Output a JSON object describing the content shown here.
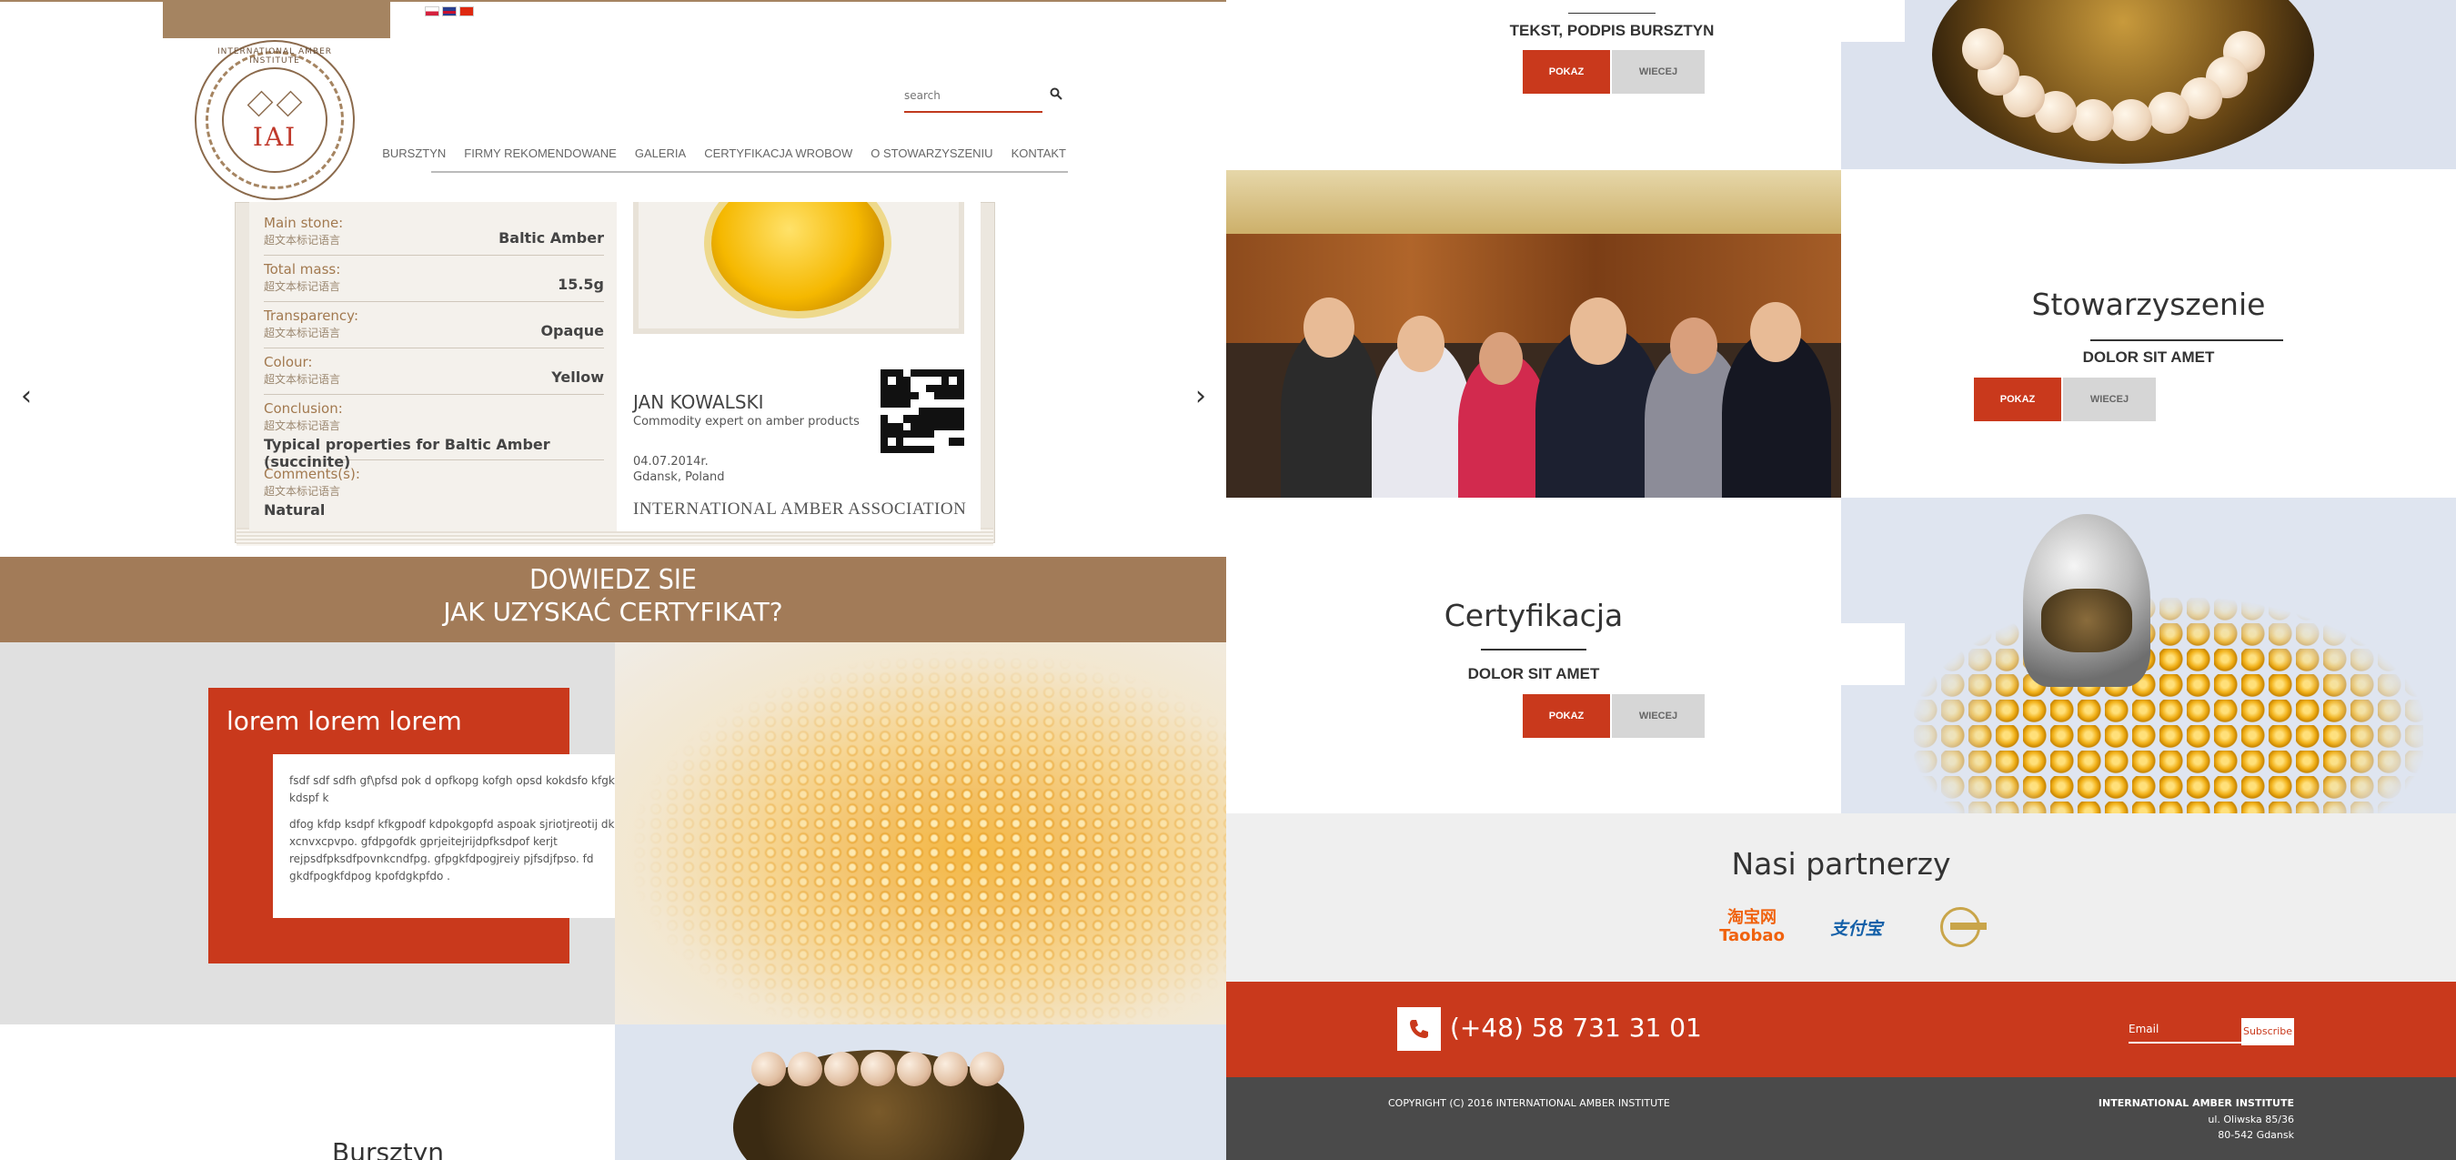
{
  "header": {
    "flags": [
      "pl-flag-icon",
      "en-flag-icon",
      "cn-flag-icon"
    ],
    "logo": {
      "arc_text": "INTERNATIONAL AMBER INSTITUTE",
      "monogram": "IAI"
    },
    "search": {
      "placeholder": "search",
      "icon": "search-icon"
    },
    "nav": [
      "BURSZTYN",
      "FIRMY REKOMENDOWANE",
      "GALERIA",
      "CERTYFIKACJA WROBOW",
      "O STOWARZYSZENIU",
      "KONTAKT"
    ]
  },
  "certificate": {
    "rows": [
      {
        "label": "Main stone:",
        "sub": "超文本标记语言",
        "value": "Baltic Amber"
      },
      {
        "label": "Total mass:",
        "sub": "超文本标记语言",
        "value": "15.5g"
      },
      {
        "label": "Transparency:",
        "sub": "超文本标记语言",
        "value": "Opaque"
      },
      {
        "label": "Colour:",
        "sub": "超文本标记语言",
        "value": "Yellow"
      },
      {
        "label": "Conclusion:",
        "sub": "超文本标记语言",
        "value": "Typical properties for Baltic Amber (succinite)"
      },
      {
        "label": "Comments(s):",
        "sub": "超文本标记语言",
        "value": "Natural"
      }
    ],
    "expert_name": "JAN KOWALSKI",
    "expert_title": "Commodity expert on amber products",
    "date": "04.07.2014r.",
    "place": "Gdansk, Poland",
    "organization": "INTERNATIONAL AMBER ASSOCIATION"
  },
  "slider": {
    "prev": "‹",
    "next": "›"
  },
  "banner": {
    "line1": "DOWIEDZ SIE",
    "line2": "JAK UZYSKAĆ CERTYFIKAT?"
  },
  "info_card": {
    "title": "lorem lorem lorem",
    "paragraph1": "fsdf sdf sdfh gf\\pfsd pok d opfkopg kofgh opsd kokdsfo kfgk dofpg kdspf k",
    "paragraph2": "dfog kfdp ksdpf kfkgpodf kdpokgopfd aspoak sjriotjreotij dk spkfspo xcnvxcpvpo. gfdpgofdk gprjeitejrijdpfksdpof kerjt rejpsdfpksdfpovnkcndfpg. gfpgkfdpogjreiy pjfsdjfpso. fd gkdfpogkfdpog kpofdgkpfdo ."
  },
  "left_bottom": {
    "title": "Bursztyn"
  },
  "right": {
    "top_block": {
      "subtitle": "TEKST, PODPIS BURSZTYN",
      "btn_primary": "POKAZ",
      "btn_secondary": "WIECEJ"
    },
    "stowarzyszenie": {
      "title": "Stowarzyszenie",
      "subtitle": "DOLOR SIT AMET",
      "btn_primary": "POKAZ",
      "btn_secondary": "WIECEJ"
    },
    "certyfikacja": {
      "title": "Certyfikacja",
      "subtitle": "DOLOR SIT AMET",
      "btn_primary": "POKAZ",
      "btn_secondary": "WIECEJ"
    },
    "partners": {
      "title": "Nasi partnerzy",
      "logos": [
        {
          "name": "taobao-logo",
          "line1": "淘宝网",
          "line2": "Taobao"
        },
        {
          "name": "alipay-logo",
          "text": "支付宝"
        },
        {
          "name": "partner-circle-logo"
        }
      ]
    },
    "contact": {
      "phone_icon": "phone-icon",
      "phone": "(+48) 58 731 31 01",
      "email_placeholder": "Email",
      "subscribe": "Subscribe"
    },
    "footer": {
      "copyright": "COPYRIGHT (C) 2016 INTERNATIONAL AMBER INSTITUTE",
      "org": "INTERNATIONAL AMBER INSTITUTE",
      "address1": "ul. Oliwska 85/36",
      "address2": "80-542 Gdansk"
    }
  },
  "colors": {
    "brand_brown": "#a27b58",
    "accent_red": "#c9391c",
    "footer_grey": "#4a4a4a"
  }
}
